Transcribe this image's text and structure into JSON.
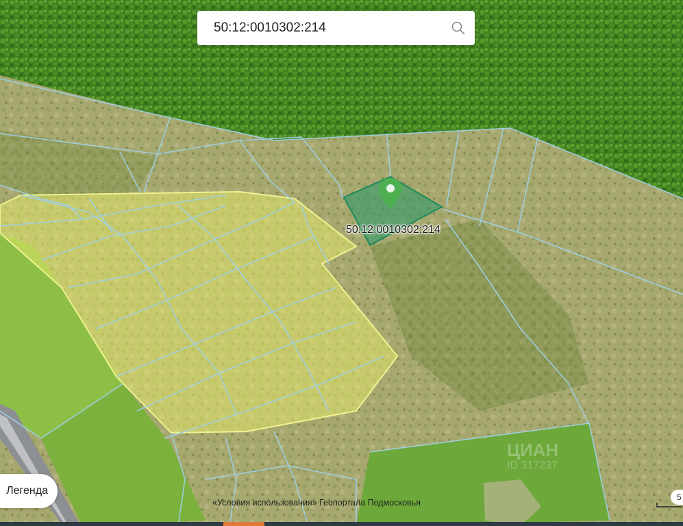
{
  "search": {
    "value": "50:12:0010302:214",
    "icon": "search-icon"
  },
  "map": {
    "parcel_label": "50:12:0010302:214",
    "marker_icon": "location-pin-icon",
    "marker_color": "#4caf50",
    "parcel_fill": "#2e9a6a",
    "parcel_stroke": "#1f8a5a",
    "boundary_color": "#9fd0e6",
    "highlight_fill": "#e8ec6a"
  },
  "legend": {
    "label": "Легенда"
  },
  "footer": {
    "terms": "«Условия использования» Геопортала Подмосковья"
  },
  "watermark": {
    "name": "ЦИАН",
    "id": "ID 317237"
  },
  "scale": {
    "label": "5"
  }
}
